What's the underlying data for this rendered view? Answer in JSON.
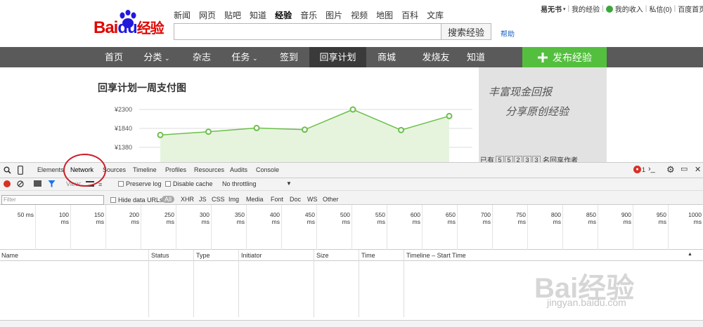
{
  "header": {
    "logo_text": "Bai",
    "logo_du": "du",
    "logo_jingyan": "经验",
    "nav_links": [
      "新闻",
      "网页",
      "贴吧",
      "知道",
      "经验",
      "音乐",
      "图片",
      "视频",
      "地图",
      "百科",
      "文库"
    ],
    "active_nav": "经验",
    "search_placeholder": "",
    "search_button": "搜索经验",
    "help": "帮助",
    "user_name": "易无书",
    "my_jingyan": "我的经验",
    "my_income": "我的收入",
    "messages": "私信(0)",
    "baidu_home": "百度首页"
  },
  "main_nav": {
    "items": [
      "首页",
      "分类",
      "杂志",
      "任务",
      "签到",
      "回享计划",
      "商城",
      "发烧友",
      "知道"
    ],
    "active": "回享计划",
    "publish": "发布经验"
  },
  "content": {
    "chart_title": "回享计划一周支付图",
    "banner_line1": "丰富现金回报",
    "banner_line2": "分享原创经验",
    "pager_prefix": "已有",
    "pager_digits": [
      "5",
      "5",
      "2",
      "3",
      "3"
    ],
    "pager_suffix": "名回享作者"
  },
  "chart_data": {
    "type": "area",
    "title": "回享计划一周支付图",
    "y_ticks": [
      "¥2300",
      "¥1840",
      "¥1380"
    ],
    "values": [
      1680,
      1760,
      1850,
      1810,
      2300,
      1800,
      2140
    ],
    "color": "#6cbf4b",
    "fill": "#e6f4dd",
    "ylim": [
      920,
      2300
    ]
  },
  "devtools": {
    "tabs": [
      "Elements",
      "Network",
      "Sources",
      "Timeline",
      "Profiles",
      "Resources",
      "Audits",
      "Console"
    ],
    "active_tab": "Network",
    "error_count": "1",
    "view_label": "View:",
    "preserve_log": "Preserve log",
    "disable_cache": "Disable cache",
    "throttling": "No throttling",
    "filter_placeholder": "Filter",
    "hide_data_urls": "Hide data URLs",
    "type_filters": [
      "All",
      "XHR",
      "JS",
      "CSS",
      "Img",
      "Media",
      "Font",
      "Doc",
      "WS",
      "Other"
    ],
    "timeline_labels": [
      "50 ms",
      "100 ms",
      "150 ms",
      "200 ms",
      "250 ms",
      "300 ms",
      "350 ms",
      "400 ms",
      "450 ms",
      "500 ms",
      "550 ms",
      "600 ms",
      "650 ms",
      "700 ms",
      "750 ms",
      "800 ms",
      "850 ms",
      "900 ms",
      "950 ms",
      "1000 ms"
    ],
    "columns": [
      "Name",
      "Status",
      "Type",
      "Initiator",
      "Size",
      "Time",
      "Timeline – Start Time"
    ]
  },
  "watermark": {
    "brand": "Bai经验",
    "url": "jingyan.baidu.com"
  },
  "colors": {
    "accent_red": "#c8202a",
    "publish_green": "#54bf3f",
    "nav_gray": "#5a5a5a"
  }
}
